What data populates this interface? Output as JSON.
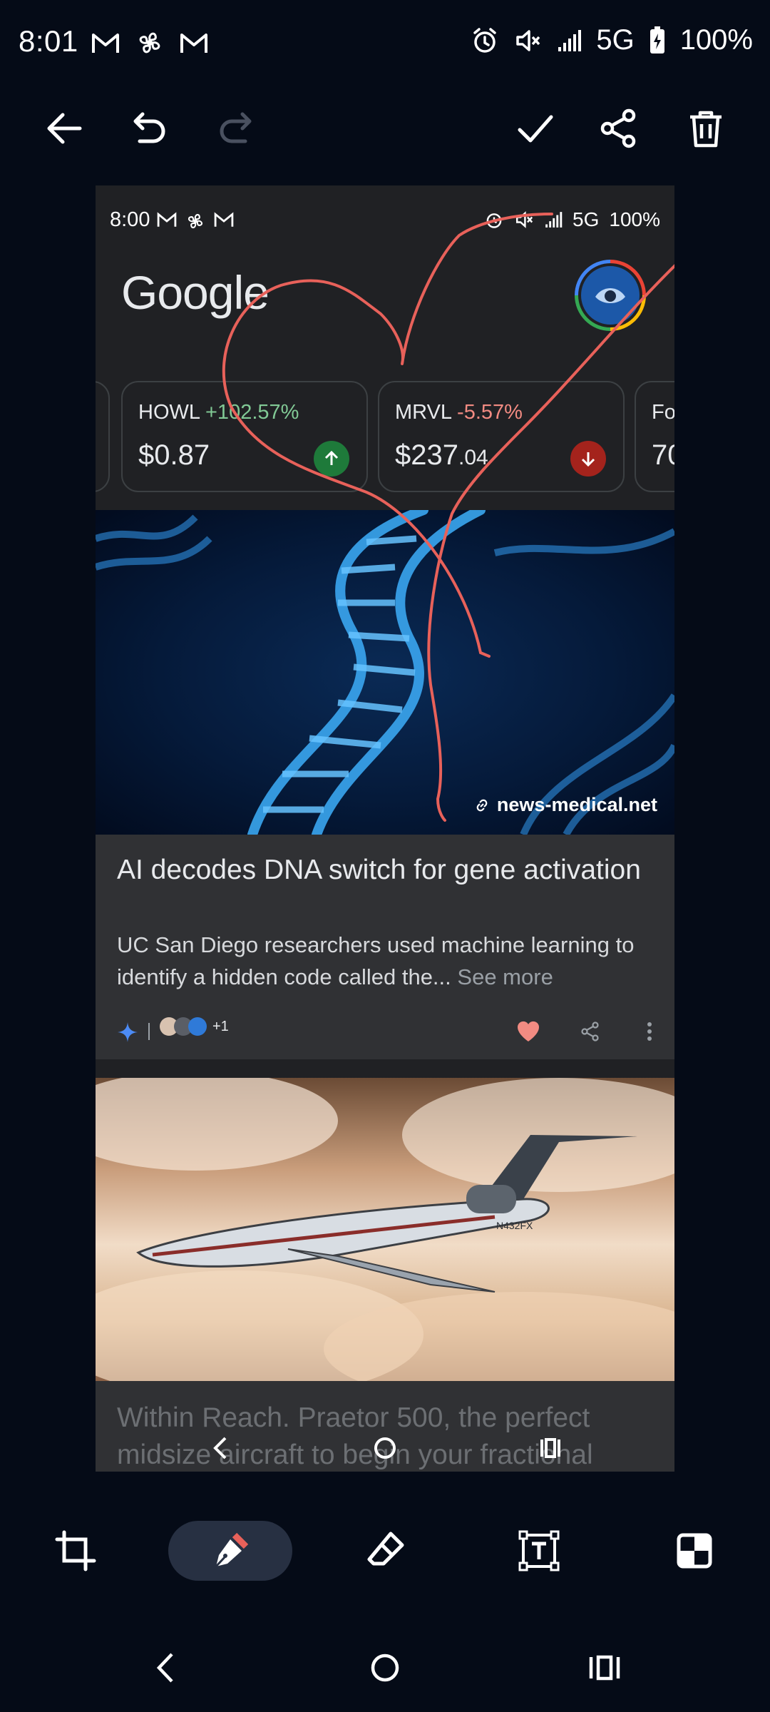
{
  "status_bar": {
    "time": "8:01",
    "network": "5G",
    "battery": "100%"
  },
  "toolbar": {
    "back_icon": "arrow-left-icon",
    "undo_icon": "undo-icon",
    "redo_icon": "redo-icon",
    "done_icon": "check-icon",
    "share_icon": "share-icon",
    "delete_icon": "trash-icon"
  },
  "screenshot": {
    "status": {
      "time": "8:00",
      "network": "5G",
      "battery": "100%"
    },
    "logo": "Google",
    "tickers": [
      {
        "symbol": "HOWL",
        "change": "+102.57%",
        "price_main": "$0.87",
        "price_cents": "",
        "direction": "up",
        "color": "#81c995"
      },
      {
        "symbol": "MRVL",
        "change": "-5.57%",
        "price_main": "$237",
        "price_cents": ".04",
        "direction": "down",
        "color": "#f28b82"
      },
      {
        "symbol": "Fo",
        "change": "",
        "price_main": "70",
        "price_cents": "",
        "direction": "",
        "color": "#e8eaed"
      }
    ],
    "card1": {
      "source": "news-medical.net",
      "headline": "AI decodes DNA switch for gene activation",
      "snippet": "UC San Diego researchers used machine learning to identify a hidden code called the...",
      "see_more": "See more",
      "publisher_count": "+1"
    },
    "card2": {
      "headline": "Within Reach. Praetor 500, the perfect midsize aircraft to begin your fractional",
      "tail_number": "N432FX"
    }
  },
  "tools": {
    "crop": "crop-icon",
    "pen": "pen-icon",
    "eraser": "eraser-icon",
    "text": "text-icon",
    "mosaic": "mosaic-icon",
    "active_tool": "pen"
  },
  "annotation_color": "#e8615a"
}
